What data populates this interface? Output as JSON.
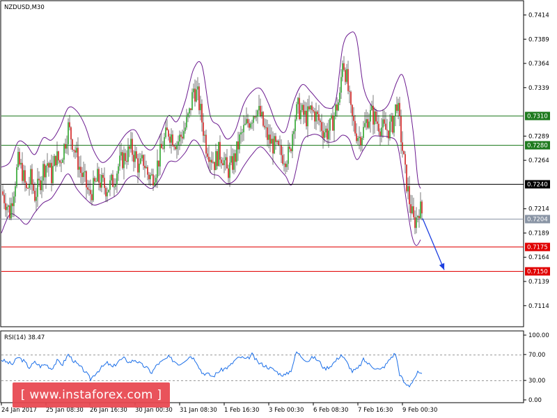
{
  "chart_data": [
    {
      "type": "candlestick",
      "title": "NZDUSD,M30",
      "y_ticks": [
        "0.7414",
        "0.7389",
        "0.7364",
        "0.7339",
        "0.7289",
        "0.7264",
        "0.7214",
        "0.7189",
        "0.7164",
        "0.7139",
        "0.7114"
      ],
      "ylim": [
        0.7093,
        0.7428
      ],
      "x_ticks": [
        "24 Jan 2017",
        "25 Jan 08:30",
        "26 Jan 16:30",
        "30 Jan 00:30",
        "31 Jan 08:30",
        "1 Feb 16:30",
        "3 Feb 00:30",
        "6 Feb 08:30",
        "7 Feb 16:30",
        "9 Feb 00:30"
      ],
      "levels": [
        {
          "value": "0.7310",
          "color": "#1e7a1e"
        },
        {
          "value": "0.7280",
          "color": "#1e7a1e"
        },
        {
          "value": "0.7240",
          "color": "#000000"
        },
        {
          "value": "0.7204",
          "color": "#8a95a5"
        },
        {
          "value": "0.7175",
          "color": "#e00000"
        },
        {
          "value": "0.7150",
          "color": "#e00000"
        }
      ],
      "price_path": [
        [
          0,
          0.7232
        ],
        [
          6,
          0.7222
        ],
        [
          12,
          0.721
        ],
        [
          18,
          0.7235
        ],
        [
          24,
          0.7262
        ],
        [
          30,
          0.7252
        ],
        [
          36,
          0.7232
        ],
        [
          42,
          0.7245
        ],
        [
          48,
          0.7228
        ],
        [
          54,
          0.7238
        ],
        [
          60,
          0.7255
        ],
        [
          66,
          0.7262
        ],
        [
          72,
          0.7248
        ],
        [
          78,
          0.7268
        ],
        [
          84,
          0.7262
        ],
        [
          90,
          0.7278
        ],
        [
          96,
          0.7298
        ],
        [
          102,
          0.7284
        ],
        [
          108,
          0.7268
        ],
        [
          114,
          0.7252
        ],
        [
          120,
          0.7242
        ],
        [
          126,
          0.7228
        ],
        [
          132,
          0.7235
        ],
        [
          138,
          0.7245
        ],
        [
          144,
          0.724
        ],
        [
          150,
          0.7236
        ],
        [
          156,
          0.7238
        ],
        [
          162,
          0.7245
        ],
        [
          168,
          0.7258
        ],
        [
          174,
          0.7265
        ],
        [
          180,
          0.727
        ],
        [
          186,
          0.7276
        ],
        [
          192,
          0.7268
        ],
        [
          198,
          0.7255
        ],
        [
          204,
          0.7264
        ],
        [
          210,
          0.725
        ],
        [
          216,
          0.7246
        ],
        [
          222,
          0.7255
        ],
        [
          228,
          0.727
        ],
        [
          234,
          0.7285
        ],
        [
          240,
          0.7294
        ],
        [
          246,
          0.7288
        ],
        [
          252,
          0.7282
        ],
        [
          258,
          0.7289
        ],
        [
          264,
          0.7298
        ],
        [
          270,
          0.7312
        ],
        [
          276,
          0.7338
        ],
        [
          282,
          0.733
        ],
        [
          288,
          0.7305
        ],
        [
          294,
          0.728
        ],
        [
          300,
          0.727
        ],
        [
          306,
          0.7262
        ],
        [
          312,
          0.7272
        ],
        [
          318,
          0.7268
        ],
        [
          324,
          0.7252
        ],
        [
          330,
          0.7258
        ],
        [
          336,
          0.7268
        ],
        [
          342,
          0.7285
        ],
        [
          348,
          0.7295
        ],
        [
          354,
          0.7303
        ],
        [
          360,
          0.731
        ],
        [
          366,
          0.7318
        ],
        [
          372,
          0.731
        ],
        [
          378,
          0.7295
        ],
        [
          384,
          0.7285
        ],
        [
          390,
          0.728
        ],
        [
          396,
          0.7275
        ],
        [
          402,
          0.727
        ],
        [
          408,
          0.7268
        ],
        [
          414,
          0.727
        ],
        [
          420,
          0.7305
        ],
        [
          426,
          0.7318
        ],
        [
          432,
          0.7312
        ],
        [
          438,
          0.7308
        ],
        [
          444,
          0.7315
        ],
        [
          450,
          0.7312
        ],
        [
          456,
          0.7305
        ],
        [
          462,
          0.7296
        ],
        [
          468,
          0.7293
        ],
        [
          474,
          0.73
        ],
        [
          480,
          0.7316
        ],
        [
          486,
          0.7328
        ],
        [
          490,
          0.737
        ],
        [
          496,
          0.7348
        ],
        [
          502,
          0.7312
        ],
        [
          508,
          0.7295
        ],
        [
          514,
          0.7288
        ],
        [
          520,
          0.7295
        ],
        [
          526,
          0.7308
        ],
        [
          532,
          0.7312
        ],
        [
          538,
          0.7305
        ],
        [
          544,
          0.73
        ],
        [
          550,
          0.7295
        ],
        [
          556,
          0.7296
        ],
        [
          562,
          0.7302
        ],
        [
          568,
          0.7325
        ],
        [
          574,
          0.7288
        ],
        [
          580,
          0.725
        ],
        [
          586,
          0.7222
        ],
        [
          592,
          0.72
        ],
        [
          596,
          0.7204
        ],
        [
          600,
          0.7215
        ],
        [
          604,
          0.721
        ]
      ],
      "bands": {
        "upper": [
          [
            0,
            0.7257
          ],
          [
            12,
            0.7262
          ],
          [
            24,
            0.7283
          ],
          [
            36,
            0.728
          ],
          [
            48,
            0.727
          ],
          [
            60,
            0.7287
          ],
          [
            72,
            0.7285
          ],
          [
            84,
            0.7298
          ],
          [
            96,
            0.7318
          ],
          [
            108,
            0.7315
          ],
          [
            120,
            0.73
          ],
          [
            132,
            0.7275
          ],
          [
            144,
            0.7262
          ],
          [
            156,
            0.7267
          ],
          [
            168,
            0.728
          ],
          [
            180,
            0.7292
          ],
          [
            192,
            0.7295
          ],
          [
            204,
            0.728
          ],
          [
            216,
            0.7275
          ],
          [
            228,
            0.729
          ],
          [
            240,
            0.731
          ],
          [
            252,
            0.7304
          ],
          [
            264,
            0.7325
          ],
          [
            276,
            0.7358
          ],
          [
            288,
            0.7362
          ],
          [
            300,
            0.731
          ],
          [
            312,
            0.73
          ],
          [
            324,
            0.7286
          ],
          [
            336,
            0.7295
          ],
          [
            348,
            0.7322
          ],
          [
            360,
            0.7335
          ],
          [
            372,
            0.7338
          ],
          [
            384,
            0.7322
          ],
          [
            396,
            0.73
          ],
          [
            408,
            0.7294
          ],
          [
            420,
            0.7325
          ],
          [
            432,
            0.7342
          ],
          [
            444,
            0.7335
          ],
          [
            456,
            0.7325
          ],
          [
            468,
            0.7318
          ],
          [
            480,
            0.7325
          ],
          [
            490,
            0.738
          ],
          [
            500,
            0.7395
          ],
          [
            510,
            0.739
          ],
          [
            520,
            0.734
          ],
          [
            532,
            0.732
          ],
          [
            544,
            0.7315
          ],
          [
            556,
            0.7322
          ],
          [
            568,
            0.7345
          ],
          [
            576,
            0.7352
          ],
          [
            584,
            0.733
          ],
          [
            592,
            0.729
          ],
          [
            598,
            0.7245
          ],
          [
            602,
            0.7235
          ]
        ],
        "lower": [
          [
            0,
            0.7189
          ],
          [
            12,
            0.7208
          ],
          [
            24,
            0.7205
          ],
          [
            36,
            0.7198
          ],
          [
            48,
            0.721
          ],
          [
            60,
            0.722
          ],
          [
            72,
            0.7225
          ],
          [
            84,
            0.7238
          ],
          [
            96,
            0.725
          ],
          [
            108,
            0.7235
          ],
          [
            120,
            0.7225
          ],
          [
            132,
            0.7218
          ],
          [
            144,
            0.722
          ],
          [
            156,
            0.7224
          ],
          [
            168,
            0.723
          ],
          [
            180,
            0.7244
          ],
          [
            192,
            0.7248
          ],
          [
            204,
            0.724
          ],
          [
            216,
            0.7235
          ],
          [
            228,
            0.7245
          ],
          [
            240,
            0.7262
          ],
          [
            252,
            0.7263
          ],
          [
            264,
            0.7272
          ],
          [
            276,
            0.7285
          ],
          [
            288,
            0.7275
          ],
          [
            300,
            0.7252
          ],
          [
            312,
            0.7248
          ],
          [
            324,
            0.724
          ],
          [
            336,
            0.7244
          ],
          [
            348,
            0.7258
          ],
          [
            360,
            0.727
          ],
          [
            372,
            0.7278
          ],
          [
            384,
            0.727
          ],
          [
            396,
            0.7258
          ],
          [
            408,
            0.7248
          ],
          [
            418,
            0.724
          ],
          [
            432,
            0.7282
          ],
          [
            444,
            0.729
          ],
          [
            456,
            0.729
          ],
          [
            468,
            0.7283
          ],
          [
            480,
            0.7284
          ],
          [
            490,
            0.729
          ],
          [
            500,
            0.7285
          ],
          [
            510,
            0.7265
          ],
          [
            520,
            0.7275
          ],
          [
            532,
            0.7288
          ],
          [
            544,
            0.7289
          ],
          [
            556,
            0.7288
          ],
          [
            568,
            0.7282
          ],
          [
            576,
            0.725
          ],
          [
            584,
            0.721
          ],
          [
            590,
            0.7185
          ],
          [
            596,
            0.7176
          ],
          [
            602,
            0.7182
          ]
        ]
      },
      "forecast_arrow": {
        "from": [
          605,
          0.7204
        ],
        "to": [
          636,
          0.7151
        ],
        "color": "#1c3fe0"
      }
    },
    {
      "type": "line",
      "title": "RSI(14) 38.47",
      "y_ticks": [
        "100.00",
        "70.00",
        "30.00",
        "0.00"
      ],
      "ylim": [
        0,
        100
      ],
      "reference_levels": [
        70,
        30
      ],
      "series": [
        {
          "color": "#1a6ee8",
          "values": [
            [
              0,
              62
            ],
            [
              8,
              58
            ],
            [
              16,
              55
            ],
            [
              24,
              66
            ],
            [
              32,
              60
            ],
            [
              40,
              50
            ],
            [
              48,
              58
            ],
            [
              56,
              52
            ],
            [
              64,
              55
            ],
            [
              72,
              48
            ],
            [
              80,
              60
            ],
            [
              88,
              55
            ],
            [
              96,
              70
            ],
            [
              104,
              60
            ],
            [
              112,
              52
            ],
            [
              120,
              44
            ],
            [
              128,
              32
            ],
            [
              136,
              42
            ],
            [
              144,
              50
            ],
            [
              152,
              57
            ],
            [
              160,
              50
            ],
            [
              168,
              60
            ],
            [
              176,
              64
            ],
            [
              184,
              58
            ],
            [
              192,
              62
            ],
            [
              200,
              55
            ],
            [
              208,
              50
            ],
            [
              216,
              42
            ],
            [
              224,
              55
            ],
            [
              232,
              60
            ],
            [
              240,
              66
            ],
            [
              248,
              60
            ],
            [
              256,
              55
            ],
            [
              264,
              62
            ],
            [
              272,
              68
            ],
            [
              280,
              60
            ],
            [
              288,
              42
            ],
            [
              296,
              40
            ],
            [
              304,
              36
            ],
            [
              312,
              44
            ],
            [
              320,
              48
            ],
            [
              328,
              52
            ],
            [
              336,
              62
            ],
            [
              344,
              66
            ],
            [
              352,
              62
            ],
            [
              360,
              70
            ],
            [
              368,
              58
            ],
            [
              376,
              54
            ],
            [
              384,
              50
            ],
            [
              392,
              46
            ],
            [
              400,
              40
            ],
            [
              408,
              38
            ],
            [
              416,
              46
            ],
            [
              424,
              74
            ],
            [
              432,
              66
            ],
            [
              440,
              60
            ],
            [
              448,
              66
            ],
            [
              456,
              60
            ],
            [
              464,
              48
            ],
            [
              472,
              52
            ],
            [
              480,
              60
            ],
            [
              488,
              70
            ],
            [
              496,
              58
            ],
            [
              504,
              44
            ],
            [
              512,
              48
            ],
            [
              520,
              62
            ],
            [
              528,
              55
            ],
            [
              536,
              50
            ],
            [
              544,
              46
            ],
            [
              552,
              54
            ],
            [
              560,
              66
            ],
            [
              566,
              72
            ],
            [
              572,
              40
            ],
            [
              580,
              24
            ],
            [
              586,
              22
            ],
            [
              592,
              32
            ],
            [
              598,
              42
            ],
            [
              604,
              38
            ]
          ]
        }
      ]
    }
  ],
  "watermark": "[  www.instaforex.com  ]"
}
